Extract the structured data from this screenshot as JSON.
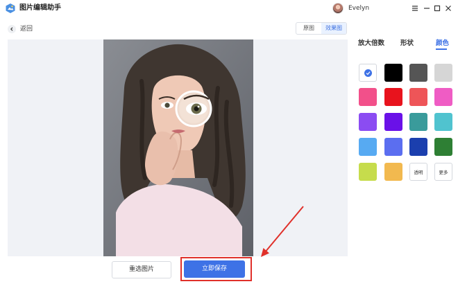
{
  "window": {
    "title": "图片编辑助手",
    "username": "Evelyn",
    "icons": [
      "app-logo-icon",
      "menu-icon",
      "minimize-icon",
      "maximize-icon",
      "close-icon"
    ]
  },
  "toolbar": {
    "back_label": "返回",
    "view_tabs": [
      {
        "label": "原图",
        "active": false
      },
      {
        "label": "效果图",
        "active": true
      }
    ]
  },
  "actions": {
    "reselect_label": "重选图片",
    "save_label": "立即保存"
  },
  "panel": {
    "tabs": [
      {
        "label": "放大倍数",
        "active": false
      },
      {
        "label": "形状",
        "active": false
      },
      {
        "label": "颜色",
        "active": true
      }
    ],
    "colors": [
      {
        "name": "white",
        "hex": "#ffffff",
        "selected": true
      },
      {
        "name": "black",
        "hex": "#000000"
      },
      {
        "name": "dark-gray",
        "hex": "#555555"
      },
      {
        "name": "light-gray",
        "hex": "#d6d6d6"
      },
      {
        "name": "pink",
        "hex": "#f2508a"
      },
      {
        "name": "red",
        "hex": "#e8131d"
      },
      {
        "name": "coral",
        "hex": "#ee5558"
      },
      {
        "name": "magenta",
        "hex": "#ef5cc4"
      },
      {
        "name": "purple",
        "hex": "#8b4cf2"
      },
      {
        "name": "violet",
        "hex": "#6a11e8"
      },
      {
        "name": "teal",
        "hex": "#3a9b9b"
      },
      {
        "name": "turquoise",
        "hex": "#50c3cf"
      },
      {
        "name": "sky-blue",
        "hex": "#57aaf2"
      },
      {
        "name": "periwinkle",
        "hex": "#5b6ef0"
      },
      {
        "name": "navy",
        "hex": "#1b3fae"
      },
      {
        "name": "green",
        "hex": "#2e7f34"
      },
      {
        "name": "lime",
        "hex": "#c6dc4c"
      },
      {
        "name": "amber",
        "hex": "#f2b94f"
      }
    ],
    "transparent_label": "透明",
    "more_label": "更多"
  },
  "accent_color": "#3e72e6",
  "annotation_color": "#e0302a"
}
